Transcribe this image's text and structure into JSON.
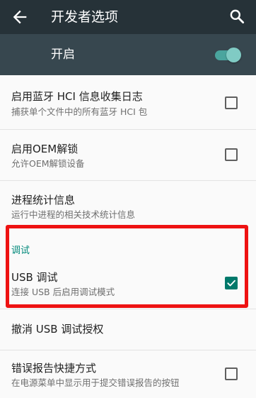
{
  "app_bar": {
    "title": "开发者选项",
    "back_icon": "arrow-back-icon",
    "search_icon": "search-icon",
    "background": "#263238"
  },
  "master_switch": {
    "label": "开启",
    "state": "on",
    "accent": "#4db6ac"
  },
  "settings": [
    {
      "title": "启用蓝牙 HCI 信息收集日志",
      "subtitle": "捕获单个文件中的所有蓝牙 HCI 包",
      "checked": false
    },
    {
      "title": "启用OEM解锁",
      "subtitle": "允许OEM解锁设备",
      "checked": false
    },
    {
      "title": "进程统计信息",
      "subtitle": "运行中进程的相关技术统计信息"
    }
  ],
  "debug_section": {
    "header": "调试",
    "header_color": "#00897b",
    "items": [
      {
        "title": "USB 调试",
        "subtitle": "连接 USB 后启用调试模式",
        "checked": true
      },
      {
        "title": "撤消 USB 调试授权"
      },
      {
        "title": "错误报告快捷方式",
        "subtitle": "在电源菜单中显示用于提交错误报告的按钮",
        "checked": false
      }
    ]
  },
  "annotation": {
    "color": "#ee1212"
  }
}
